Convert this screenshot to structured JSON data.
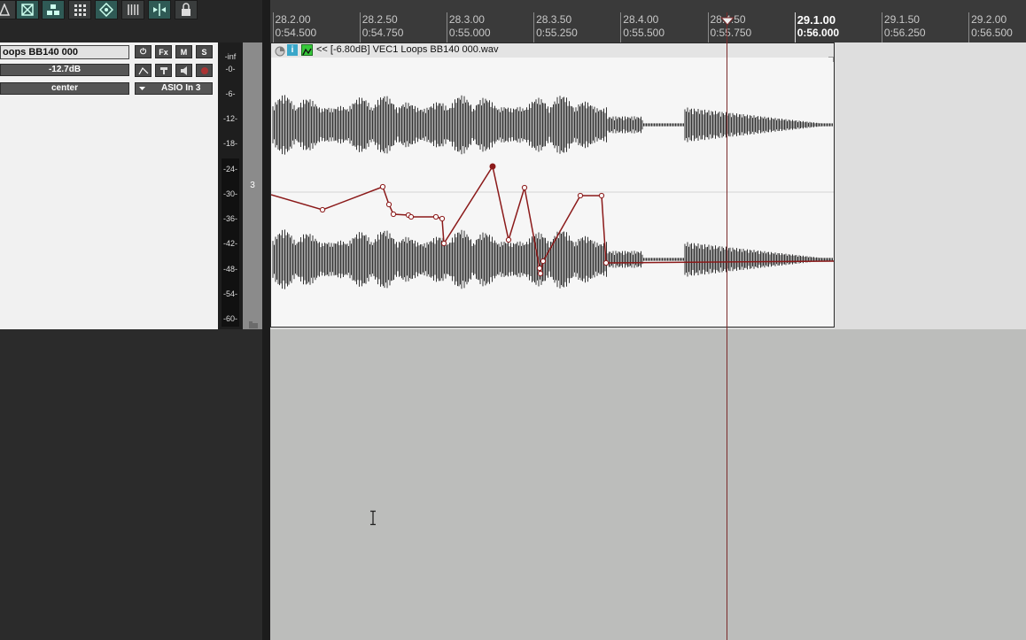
{
  "track": {
    "name": "oops BB140 000",
    "volume": "-12.7dB",
    "pan": "center",
    "input": "ASIO In 3",
    "number": "3",
    "buttons": {
      "power": "⏻",
      "fx": "Fx",
      "mute": "M",
      "solo": "S"
    }
  },
  "meter": {
    "labels": [
      "-inf",
      "-0-",
      "-6-",
      "-12-",
      "-18-",
      "-24-",
      "-30-",
      "-36-",
      "-42-",
      "-48-",
      "-54-",
      "-60-"
    ]
  },
  "ruler": {
    "ticks": [
      {
        "measure": "28.2.00",
        "time": "0:54.500"
      },
      {
        "measure": "28.2.50",
        "time": "0:54.750"
      },
      {
        "measure": "28.3.00",
        "time": "0:55.000"
      },
      {
        "measure": "28.3.50",
        "time": "0:55.250"
      },
      {
        "measure": "28.4.00",
        "time": "0:55.500"
      },
      {
        "measure": "28.4.50",
        "time": "0:55.750"
      },
      {
        "measure": "29.1.00",
        "time": "0:56.000"
      },
      {
        "measure": "29.1.50",
        "time": "0:56.250"
      },
      {
        "measure": "29.2.00",
        "time": "0:56.500"
      }
    ]
  },
  "item": {
    "label": "<< [-6.80dB] VEC1 Loops BB140 000.wav"
  },
  "colors": {
    "envelope": "#8b1a1a",
    "waveform": "#333333",
    "accent": "#2f5a55"
  },
  "toolbar": {
    "icons": [
      "metronome-icon",
      "ripple-icon",
      "grouping-icon",
      "snap-grid-icon",
      "envelope-points-icon",
      "grid-lines-icon",
      "split-icon",
      "lock-icon"
    ]
  }
}
